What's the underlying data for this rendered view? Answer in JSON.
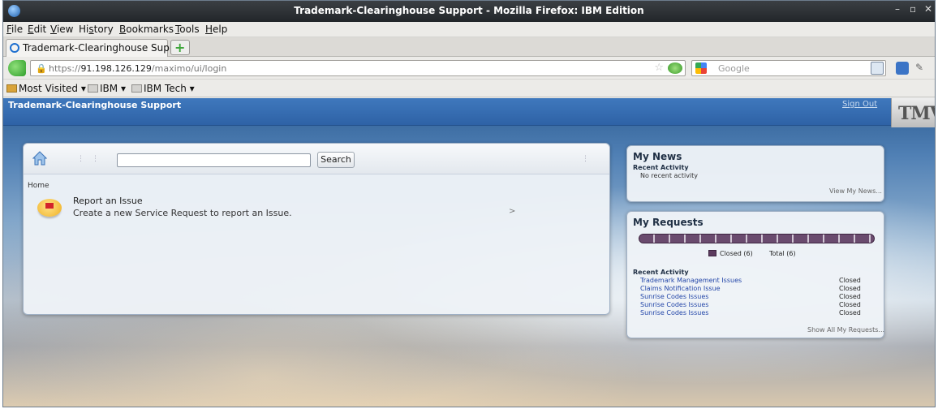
{
  "window": {
    "title": "Trademark-Clearinghouse Support - Mozilla Firefox: IBM Edition",
    "controls": [
      "–",
      "▫",
      "✕"
    ]
  },
  "menu": [
    "File",
    "Edit",
    "View",
    "History",
    "Bookmarks",
    "Tools",
    "Help"
  ],
  "menu_mnemonics": [
    "F",
    "E",
    "V",
    "s",
    "B",
    "T",
    "H"
  ],
  "tab": {
    "label": "Trademark-Clearinghouse Support",
    "new_tab_symbol": "+"
  },
  "navbar": {
    "url_prefix": "https://",
    "url_host": "91.198.126.129",
    "url_path": "/maximo/ui/login",
    "search_engine": "Google"
  },
  "bookmarks": [
    "Most Visited",
    "IBM",
    "IBM Tech"
  ],
  "page": {
    "app_title": "Trademark-Clearinghouse Support",
    "sign_out": "Sign Out",
    "logo_text": "TMV"
  },
  "main_panel": {
    "search_button": "Search",
    "breadcrumb": "Home",
    "report": {
      "title": "Report an Issue",
      "description": "Create a new Service Request to report an Issue.",
      "arrow": ">"
    }
  },
  "news": {
    "title": "My News",
    "subtitle": "Recent Activity",
    "empty_text": "No recent activity",
    "link": "View My News..."
  },
  "requests": {
    "title": "My Requests",
    "closed_label": "Closed (6)",
    "total_label": "Total (6)",
    "closed_fraction": 1.0,
    "subtitle": "Recent Activity",
    "items": [
      {
        "name": "Trademark Management Issues",
        "status": "Closed"
      },
      {
        "name": "Claims Notification Issue",
        "status": "Closed"
      },
      {
        "name": "Sunrise Codes Issues",
        "status": "Closed"
      },
      {
        "name": "Sunrise Codes Issues",
        "status": "Closed"
      },
      {
        "name": "Sunrise Codes Issues",
        "status": "Closed"
      }
    ],
    "show_all": "Show All My Requests..."
  }
}
